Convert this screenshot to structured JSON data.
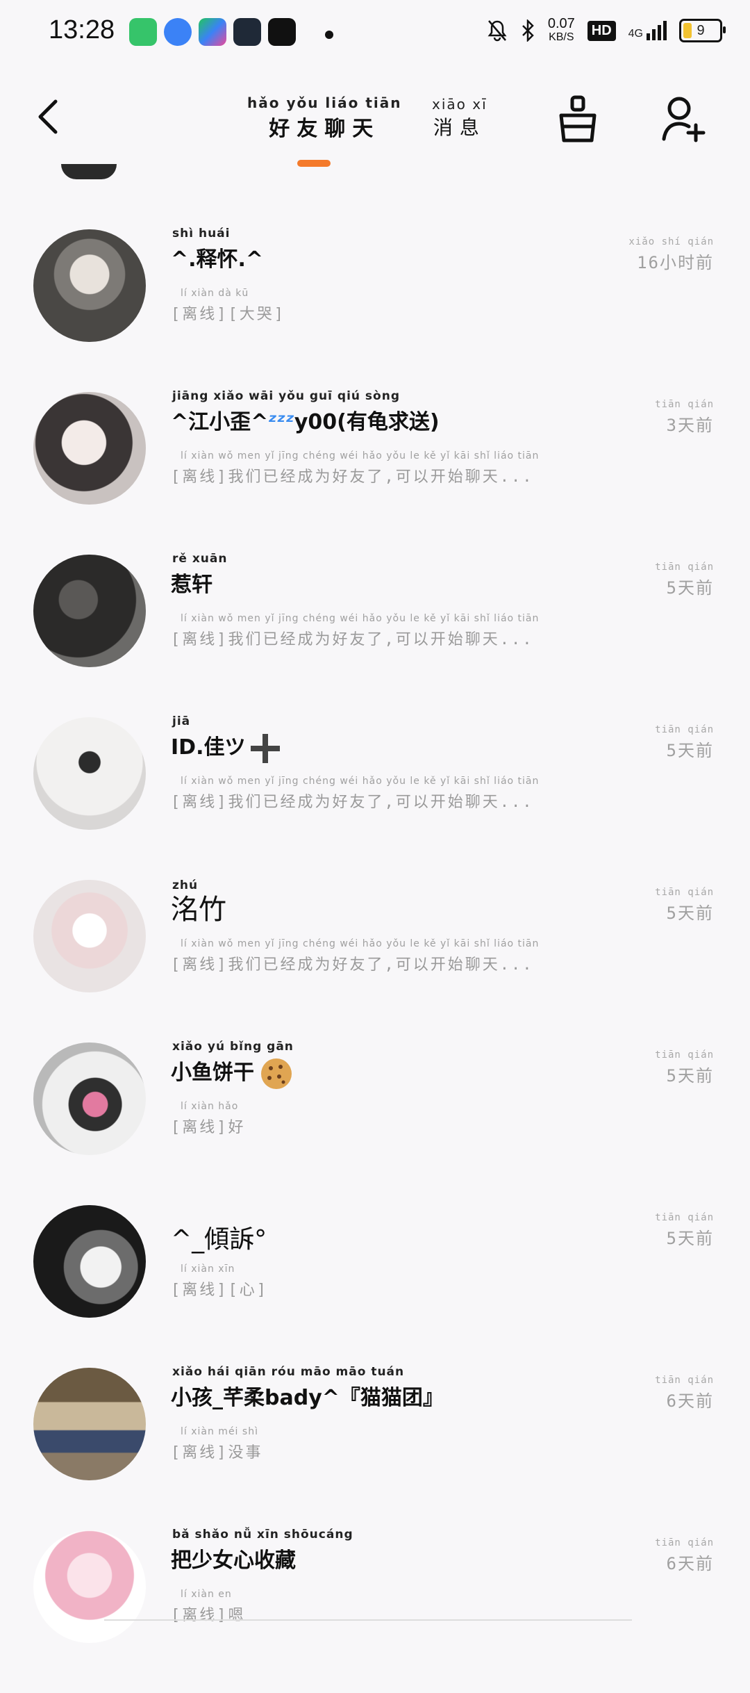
{
  "status_bar": {
    "time": "13:28",
    "net_speed_value": "0.07",
    "net_speed_unit": "KB/S",
    "hd": "HD",
    "network": "4G",
    "battery": "9"
  },
  "header": {
    "tab_friends_pinyin": "hǎo yǒu liáo tiān",
    "tab_friends_label": "好友聊天",
    "tab_messages_pinyin": "xiāo xī",
    "tab_messages_label": "消息",
    "accent_color": "#f47a2b"
  },
  "chats": [
    {
      "name": "^.释怀.^",
      "name_pinyin": "shì huái",
      "preview": "[离线][大哭]",
      "preview_pinyin": "lí xiàn   dà kū",
      "time": "16小时前",
      "time_pinyin": "xiǎo shí qián"
    },
    {
      "name": "^江小歪^",
      "name_suffix": "y00(有龟求送)",
      "zzz": "ᶻᶻᶻ",
      "name_pinyin": "jiāng xiǎo wāi         yǒu guī qiú sòng",
      "preview": "[离线]我们已经成为好友了,可以开始聊天...",
      "preview_pinyin": "lí xiàn  wǒ men yǐ jīng chéng wéi hǎo yǒu le  kě yǐ kāi shǐ liáo tiān",
      "time": "3天前",
      "time_pinyin": "tiān qián"
    },
    {
      "name": "惹轩",
      "name_pinyin": "rě xuān",
      "preview": "[离线]我们已经成为好友了,可以开始聊天...",
      "preview_pinyin": "lí xiàn  wǒ men yǐ jīng chéng wéi hǎo yǒu le  kě yǐ kāi shǐ liáo tiān",
      "time": "5天前",
      "time_pinyin": "tiān qián"
    },
    {
      "name": "ID.佳ツ",
      "name_pinyin": "   jiā",
      "preview": "[离线]我们已经成为好友了,可以开始聊天...",
      "preview_pinyin": "lí xiàn  wǒ men yǐ jīng chéng wéi hǎo yǒu le  kě yǐ kāi shǐ liáo tiān",
      "time": "5天前",
      "time_pinyin": "tiān qián"
    },
    {
      "name": "洺竹",
      "name_pinyin": "     zhú",
      "preview": "[离线]我们已经成为好友了,可以开始聊天...",
      "preview_pinyin": "lí xiàn  wǒ men yǐ jīng chéng wéi hǎo yǒu le  kě yǐ kāi shǐ liáo tiān",
      "time": "5天前",
      "time_pinyin": "tiān qián"
    },
    {
      "name": "小鱼饼干",
      "name_pinyin": "xiǎo yú bǐng gān",
      "preview": "[离线]好",
      "preview_pinyin": "lí xiàn  hǎo",
      "time": "5天前",
      "time_pinyin": "tiān qián"
    },
    {
      "name": "^_傾訴°",
      "name_pinyin": "",
      "preview": "[离线][心]",
      "preview_pinyin": "lí xiàn   xīn",
      "time": "5天前",
      "time_pinyin": "tiān qián"
    },
    {
      "name": "小孩_芊柔bady^『猫猫团』",
      "name_pinyin": "xiǎo hái  qiān róu           māo māo tuán",
      "preview": "[离线]没事",
      "preview_pinyin": "lí xiàn  méi shì",
      "time": "6天前",
      "time_pinyin": "tiān qián"
    },
    {
      "name": "把少女心收藏",
      "name_pinyin": "bǎ shǎo nǚ xīn shōucáng",
      "preview": "[离线]嗯",
      "preview_pinyin": "lí xiàn  en",
      "time": "6天前",
      "time_pinyin": "tiān qián"
    }
  ]
}
